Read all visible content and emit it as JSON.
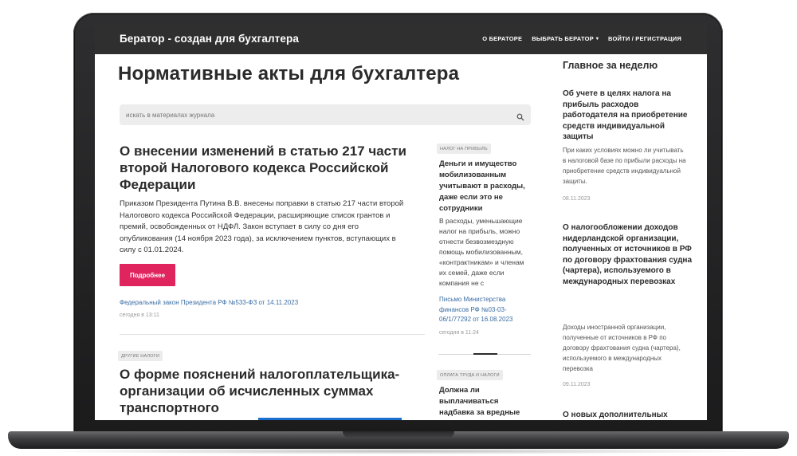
{
  "header": {
    "brand": "Бератор - создан для бухгалтера",
    "nav": {
      "about": "О БЕРАТОРЕ",
      "choose": "ВЫБРАТЬ БЕРАТОР",
      "login": "ВОЙТИ / РЕГИСТРАЦИЯ"
    }
  },
  "main": {
    "page_title": "Нормативные акты для бухгалтера",
    "search_placeholder": "искать в материалах журнала",
    "article1": {
      "title": "О внесении изменений в статью 217 части второй Налогового кодекса Российской Федерации",
      "lead": "Приказом Президента Путина В.В. внесены поправки в статью 217 части второй Налогового кодекса Российской Федерации, расширяющие список грантов и премий, освобожденных от НДФЛ. Закон вступает в силу со дня его опубликования (14 ноября 2023 года), за исключением пунктов, вступающих в силу с 01.01.2024.",
      "button": "Подробнее",
      "source": "Федеральный закон Президента РФ №533-ФЗ от 14.11.2023",
      "time": "сегодня в 13:11"
    },
    "article2": {
      "tag": "ДРУГИЕ НАЛОГИ",
      "title": "О форме пояснений налогоплательщика-организации об исчисленных суммах транспортного"
    }
  },
  "middle": {
    "item1": {
      "tag": "НАЛОГ НА ПРИБЫЛЬ",
      "title": "Деньги и имущество мобилизованным учитывают в расходы, даже если это не сотрудники",
      "lead": "В расходы, уменьшающие налог на прибыль, можно отнести безвозмездную помощь мобилизованным, «контрактникам» и членам их семей, даже если компания не с",
      "source": "Письмо Министерства финансов РФ №03-03-06/1/77292 от 16.08.2023",
      "time": "сегодня в 11:24"
    },
    "item2": {
      "tag": "ОПЛАТА ТРУДА И НАЛОГИ",
      "title": "Должна ли выплачиваться надбавка за вредные"
    }
  },
  "sidebar": {
    "heading": "Главное за неделю",
    "items": [
      {
        "title": "Об учете в целях налога на прибыль расходов работодателя на приобретение средств индивидуальной защиты",
        "lead": "При каких условиях можно ли учитывать в налоговой базе по прибыли расходы на приобретение средств индивидуальной защиты.",
        "date": "08.11.2023"
      },
      {
        "title": "О налогообложении доходов нидерландской организации, полученных от источников в РФ по договору фрахтования судна (чартера), используемого в международных перевозках",
        "lead": "Доходы иностранной организации, полученные от источников в РФ по договору фрахтования судна (чартера), используемого в международных перевозка",
        "date": "09.11.2023"
      },
      {
        "title": "О новых дополнительных"
      }
    ]
  },
  "colors": {
    "header_bg": "#2f2f2f",
    "accent_button": "#e0245e",
    "link": "#3b6ea5"
  },
  "icons": [
    "search-icon",
    "caret-down-icon"
  ]
}
